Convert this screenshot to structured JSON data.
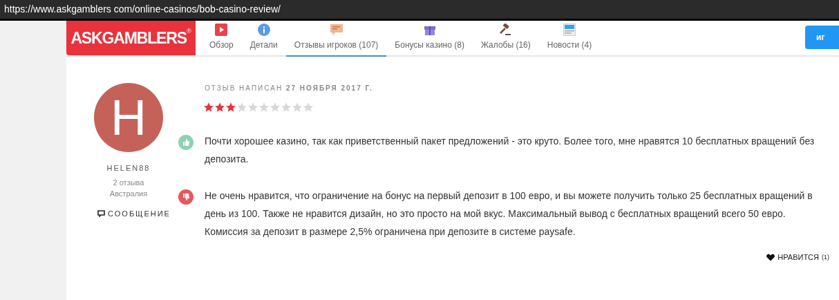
{
  "address_bar": {
    "url": "https://www.askgamblers com/online-casinos/bob-casino-review/"
  },
  "header": {
    "logo": "ASKGAMBLERS",
    "logo_mark": "®",
    "tabs": [
      {
        "kind": "play",
        "label": "Обзор",
        "selected": false
      },
      {
        "kind": "info",
        "label": "Детали",
        "selected": false
      },
      {
        "kind": "chat",
        "label": "Отзывы игроков (107)",
        "selected": true
      },
      {
        "kind": "gift",
        "label": "Бонусы казино (8)",
        "selected": false
      },
      {
        "kind": "gavel",
        "label": "Жалобы (16)",
        "selected": false
      },
      {
        "kind": "news",
        "label": "Новости (4)",
        "selected": false
      }
    ],
    "button": "иг"
  },
  "review": {
    "author": {
      "initial": "H",
      "name": "HELEN88",
      "reviews": "2 отзыва",
      "country": "Австралия",
      "message": "СООБЩЕНИЕ"
    },
    "date": "ОТЗЫВ НАПИСАН **27 НОЯБРЯ 2017 Г.**",
    "stars": 3,
    "points": [
      {
        "kind": "pro",
        "text": "Почти хорошее казино, так как приветственный пакет предложений - это круто. Более того, мне нравятся 10 бесплатных вращений без депозита."
      },
      {
        "kind": "con",
        "text": "Не очень нравится, что ограничение на бонус на первый депозит в 100 евро, и вы можете получить только 25 бесплатных вращений в день из 100. Также не нравится дизайн, но это просто на мой вкус. Максимальный вывод с бесплатных вращений всего 50 евро. Комиссия за депозит в размере 2,5% ограничена при депозите в системе paysafe."
      }
    ],
    "like": {
      "label": "НРАВИТСЯ",
      "count": "(1)"
    }
  }
}
